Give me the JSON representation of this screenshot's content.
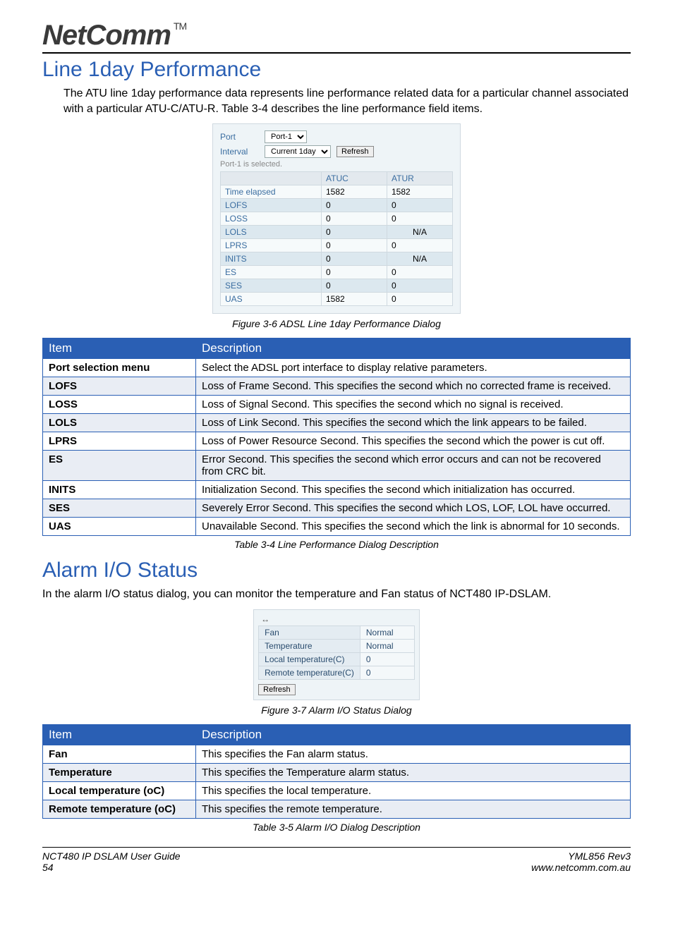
{
  "logo": {
    "text": "NetComm",
    "tm": "TM"
  },
  "section1": {
    "title": "Line 1day Performance",
    "body": "The ATU line 1day performance data represents line performance related data for a particular channel associated with a particular ATU-C/ATU-R. Table 3-4 describes the line performance field items."
  },
  "perf_dialog": {
    "port_label": "Port",
    "port_value": "Port-1",
    "interval_label": "Interval",
    "interval_value": "Current 1day",
    "refresh": "Refresh",
    "selected_note": "Port-1 is selected.",
    "col1": "ATUC",
    "col2": "ATUR",
    "rows": [
      {
        "name": "Time elapsed",
        "c": "1582",
        "r": "1582",
        "alt": false
      },
      {
        "name": "LOFS",
        "c": "0",
        "r": "0",
        "alt": true
      },
      {
        "name": "LOSS",
        "c": "0",
        "r": "0",
        "alt": false
      },
      {
        "name": "LOLS",
        "c": "0",
        "r": "N/A",
        "alt": true,
        "na": true
      },
      {
        "name": "LPRS",
        "c": "0",
        "r": "0",
        "alt": false
      },
      {
        "name": "INITS",
        "c": "0",
        "r": "N/A",
        "alt": true,
        "na": true
      },
      {
        "name": "ES",
        "c": "0",
        "r": "0",
        "alt": false
      },
      {
        "name": "SES",
        "c": "0",
        "r": "0",
        "alt": true
      },
      {
        "name": "UAS",
        "c": "1582",
        "r": "0",
        "alt": false
      }
    ]
  },
  "caption1": "Figure 3-6 ADSL Line 1day Performance Dialog",
  "table1": {
    "h1": "Item",
    "h2": "Description",
    "rows": [
      {
        "item": "Port selection menu",
        "desc": "Select the ADSL port interface to display  relative parameters."
      },
      {
        "item": "LOFS",
        "desc": "Loss of Frame Second. This specifies the second which no corrected frame is received."
      },
      {
        "item": "LOSS",
        "desc": "Loss of Signal Second. This specifies the second which no signal is received."
      },
      {
        "item": "LOLS",
        "desc": "Loss of Link Second. This specifies the second which the link appears to be failed."
      },
      {
        "item": "LPRS",
        "desc": "Loss of Power Resource Second. This specifies the second which the power is cut off."
      },
      {
        "item": "ES",
        "desc": "Error Second. This specifies the second which error occurs and can not be recovered from CRC bit."
      },
      {
        "item": "INITS",
        "desc": "Initialization Second. This specifies the second which initialization has occurred."
      },
      {
        "item": "SES",
        "desc": "Severely Error Second. This specifies the second which LOS, LOF, LOL have occurred."
      },
      {
        "item": "UAS",
        "desc": "Unavailable Second. This specifies the second which the link is abnormal for 10 seconds."
      }
    ]
  },
  "caption2": "Table 3-4 Line Performance Dialog Description",
  "section2": {
    "title": "Alarm I/O Status",
    "body": "In the alarm I/O status dialog, you can monitor the temperature and Fan status of NCT480 IP-DSLAM."
  },
  "alarm_dialog": {
    "arrow": "↔",
    "rows": [
      {
        "name": "Fan",
        "val": "Normal"
      },
      {
        "name": "Temperature",
        "val": "Normal"
      },
      {
        "name": "Local temperature(C)",
        "val": "0"
      },
      {
        "name": "Remote temperature(C)",
        "val": "0"
      }
    ],
    "refresh": "Refresh"
  },
  "caption3": "Figure 3-7 Alarm I/O Status Dialog",
  "table2": {
    "h1": "Item",
    "h2": "Description",
    "rows": [
      {
        "item": "Fan",
        "desc": "This specifies the Fan alarm status."
      },
      {
        "item": "Temperature",
        "desc": "This specifies the Temperature alarm status."
      },
      {
        "item": "Local temperature (oC)",
        "desc": "This specifies the local temperature."
      },
      {
        "item": "Remote temperature (oC)",
        "desc": "This specifies the remote temperature."
      }
    ]
  },
  "caption4": "Table 3-5 Alarm I/O Dialog Description",
  "footer": {
    "doc": "NCT480 IP DSLAM User Guide",
    "page": "54",
    "rev": "YML856 Rev3",
    "url": "www.netcomm.com.au"
  }
}
